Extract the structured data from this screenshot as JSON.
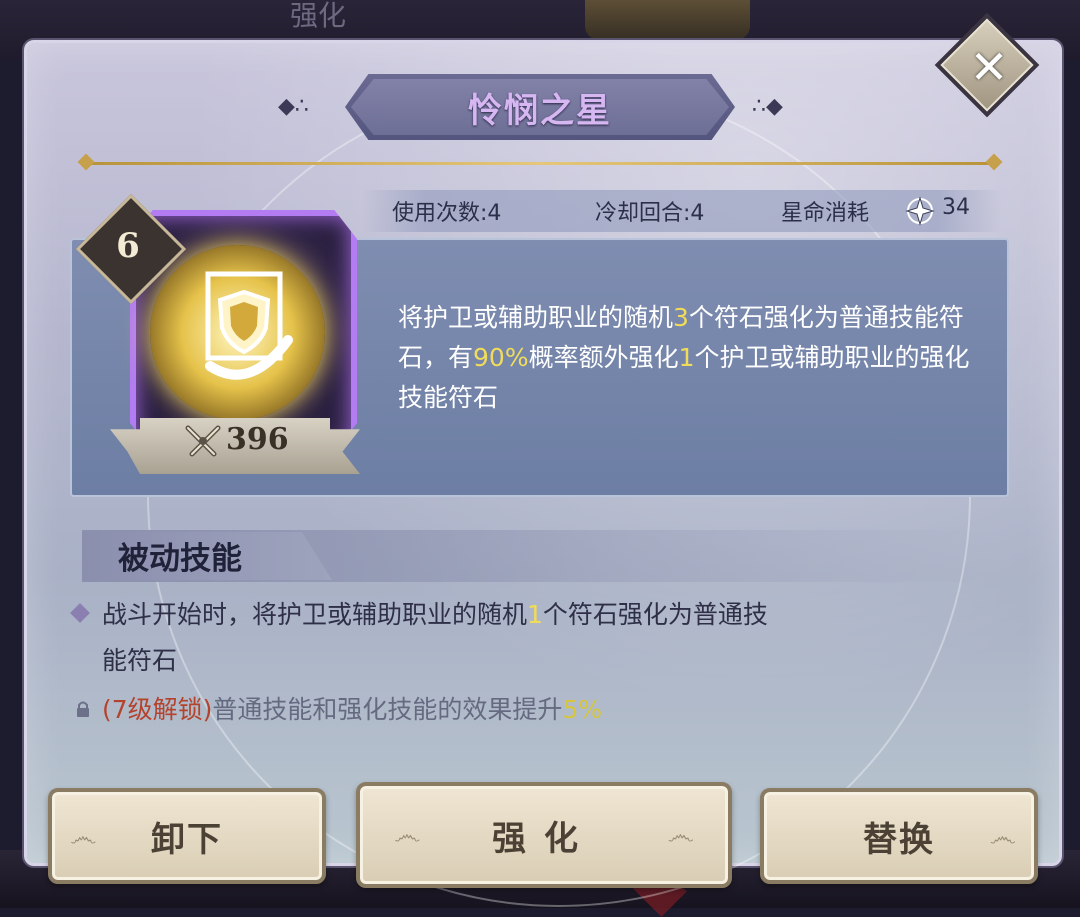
{
  "background": {
    "top_label": "强化"
  },
  "dialog": {
    "title": "怜悯之星",
    "stats": {
      "uses_label": "使用次数:",
      "uses_value": "4",
      "cooldown_label": "冷却回合:",
      "cooldown_value": "4",
      "cost_label": "星命消耗",
      "cost_value": "34"
    },
    "skill": {
      "level": "6",
      "power": "396",
      "desc": {
        "p1": "将护卫或辅助职业的随机",
        "n1": "3",
        "p2": "个符石强化为普通技能符石，有",
        "n2": "90%",
        "p3": "概率额外强化",
        "n3": "1",
        "p4": "个护卫或辅助职业的强化技能符石"
      }
    },
    "passive": {
      "title": "被动技能",
      "line1_a": "战斗开始时，将护卫或辅助职业的随机",
      "line1_n": "1",
      "line1_b": "个符石强化为普通技",
      "line2": "能符石",
      "locked_tag": "(7级解锁)",
      "locked_text": "普通技能和强化技能的效果提升",
      "locked_value": "5%"
    },
    "buttons": {
      "unequip": "卸下",
      "enhance": "强化",
      "replace": "替换"
    }
  },
  "colors": {
    "highlight": "#f1dc5a",
    "locked_tag": "#b4432d",
    "title_text": "#d6b7f2",
    "icon_glow": "#c98bff"
  },
  "icons": [
    "close-icon",
    "star-icon",
    "shield-icon",
    "crossed-swords-icon",
    "lock-icon"
  ]
}
